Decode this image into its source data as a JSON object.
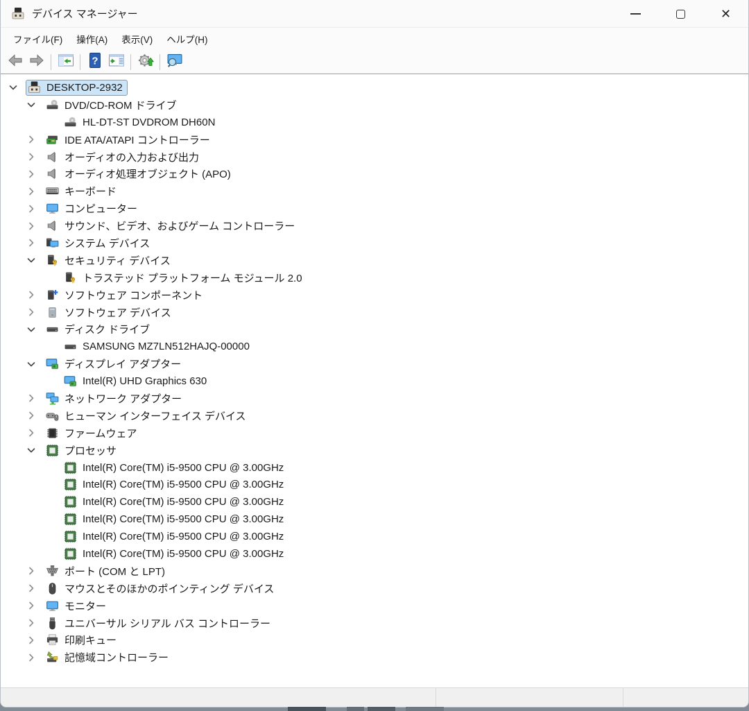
{
  "window": {
    "title": "デバイス マネージャー",
    "controls": {
      "minimize": "minimize",
      "maximize": "maximize",
      "close": "close"
    }
  },
  "menu": {
    "items": [
      {
        "id": "file",
        "label": "ファイル(F)"
      },
      {
        "id": "action",
        "label": "操作(A)"
      },
      {
        "id": "view",
        "label": "表示(V)"
      },
      {
        "id": "help",
        "label": "ヘルプ(H)"
      }
    ]
  },
  "toolbar": {
    "buttons": [
      {
        "id": "back",
        "icon": "back-arrow"
      },
      {
        "id": "forward",
        "icon": "forward-arrow"
      },
      {
        "sep": true
      },
      {
        "id": "show-console-tree",
        "icon": "console-tree"
      },
      {
        "sep": true
      },
      {
        "id": "help",
        "icon": "help"
      },
      {
        "id": "action-pane",
        "icon": "action-pane"
      },
      {
        "sep": true
      },
      {
        "id": "update-driver",
        "icon": "update-driver"
      },
      {
        "sep": true
      },
      {
        "id": "scan-hardware-changes",
        "icon": "scan-hardware"
      }
    ]
  },
  "tree": {
    "items": [
      {
        "level": 0,
        "state": "expanded",
        "icon": "computer",
        "label": "DESKTOP-2932",
        "selected": true
      },
      {
        "level": 1,
        "state": "expanded",
        "icon": "disc-drive",
        "label": "DVD/CD-ROM ドライブ"
      },
      {
        "level": 2,
        "state": "none",
        "icon": "disc-drive",
        "label": "HL-DT-ST DVDROM DH60N"
      },
      {
        "level": 1,
        "state": "collapsed",
        "icon": "ide-controller",
        "label": "IDE ATA/ATAPI コントローラー"
      },
      {
        "level": 1,
        "state": "collapsed",
        "icon": "speaker",
        "label": "オーディオの入力および出力"
      },
      {
        "level": 1,
        "state": "collapsed",
        "icon": "speaker",
        "label": "オーディオ処理オブジェクト (APO)"
      },
      {
        "level": 1,
        "state": "collapsed",
        "icon": "keyboard",
        "label": "キーボード"
      },
      {
        "level": 1,
        "state": "collapsed",
        "icon": "monitor",
        "label": "コンピューター"
      },
      {
        "level": 1,
        "state": "collapsed",
        "icon": "speaker",
        "label": "サウンド、ビデオ、およびゲーム コントローラー"
      },
      {
        "level": 1,
        "state": "collapsed",
        "icon": "system-device",
        "label": "システム デバイス"
      },
      {
        "level": 1,
        "state": "expanded",
        "icon": "security-device",
        "label": "セキュリティ デバイス"
      },
      {
        "level": 2,
        "state": "none",
        "icon": "security-device",
        "label": "トラステッド プラットフォーム モジュール 2.0"
      },
      {
        "level": 1,
        "state": "collapsed",
        "icon": "software-component",
        "label": "ソフトウェア コンポーネント"
      },
      {
        "level": 1,
        "state": "collapsed",
        "icon": "software-device",
        "label": "ソフトウェア デバイス"
      },
      {
        "level": 1,
        "state": "expanded",
        "icon": "disk-drive",
        "label": "ディスク ドライブ"
      },
      {
        "level": 2,
        "state": "none",
        "icon": "disk-drive",
        "label": "SAMSUNG MZ7LN512HAJQ-00000"
      },
      {
        "level": 1,
        "state": "expanded",
        "icon": "display-adapter",
        "label": "ディスプレイ アダプター"
      },
      {
        "level": 2,
        "state": "none",
        "icon": "display-adapter",
        "label": "Intel(R) UHD Graphics 630"
      },
      {
        "level": 1,
        "state": "collapsed",
        "icon": "network-adapter",
        "label": "ネットワーク アダプター"
      },
      {
        "level": 1,
        "state": "collapsed",
        "icon": "hid",
        "label": "ヒューマン インターフェイス デバイス"
      },
      {
        "level": 1,
        "state": "collapsed",
        "icon": "firmware",
        "label": "ファームウェア"
      },
      {
        "level": 1,
        "state": "expanded",
        "icon": "processor",
        "label": "プロセッサ"
      },
      {
        "level": 2,
        "state": "none",
        "icon": "processor",
        "label": "Intel(R) Core(TM) i5-9500 CPU @ 3.00GHz"
      },
      {
        "level": 2,
        "state": "none",
        "icon": "processor",
        "label": "Intel(R) Core(TM) i5-9500 CPU @ 3.00GHz"
      },
      {
        "level": 2,
        "state": "none",
        "icon": "processor",
        "label": "Intel(R) Core(TM) i5-9500 CPU @ 3.00GHz"
      },
      {
        "level": 2,
        "state": "none",
        "icon": "processor",
        "label": "Intel(R) Core(TM) i5-9500 CPU @ 3.00GHz"
      },
      {
        "level": 2,
        "state": "none",
        "icon": "processor",
        "label": "Intel(R) Core(TM) i5-9500 CPU @ 3.00GHz"
      },
      {
        "level": 2,
        "state": "none",
        "icon": "processor",
        "label": "Intel(R) Core(TM) i5-9500 CPU @ 3.00GHz"
      },
      {
        "level": 1,
        "state": "collapsed",
        "icon": "port",
        "label": "ポート (COM と LPT)"
      },
      {
        "level": 1,
        "state": "collapsed",
        "icon": "mouse",
        "label": "マウスとそのほかのポインティング デバイス"
      },
      {
        "level": 1,
        "state": "collapsed",
        "icon": "monitor",
        "label": "モニター"
      },
      {
        "level": 1,
        "state": "collapsed",
        "icon": "usb",
        "label": "ユニバーサル シリアル バス コントローラー"
      },
      {
        "level": 1,
        "state": "collapsed",
        "icon": "print-queue",
        "label": "印刷キュー"
      },
      {
        "level": 1,
        "state": "collapsed",
        "icon": "storage-controller",
        "label": "記憶域コントローラー"
      }
    ]
  },
  "statusbar": {
    "sections": [
      "",
      "",
      ""
    ]
  },
  "colors": {
    "selection_bg": "#cce4f7",
    "selection_border": "#66a1d8",
    "statusbar_bg": "#f0f0f0",
    "backdrop": "#828c97"
  }
}
